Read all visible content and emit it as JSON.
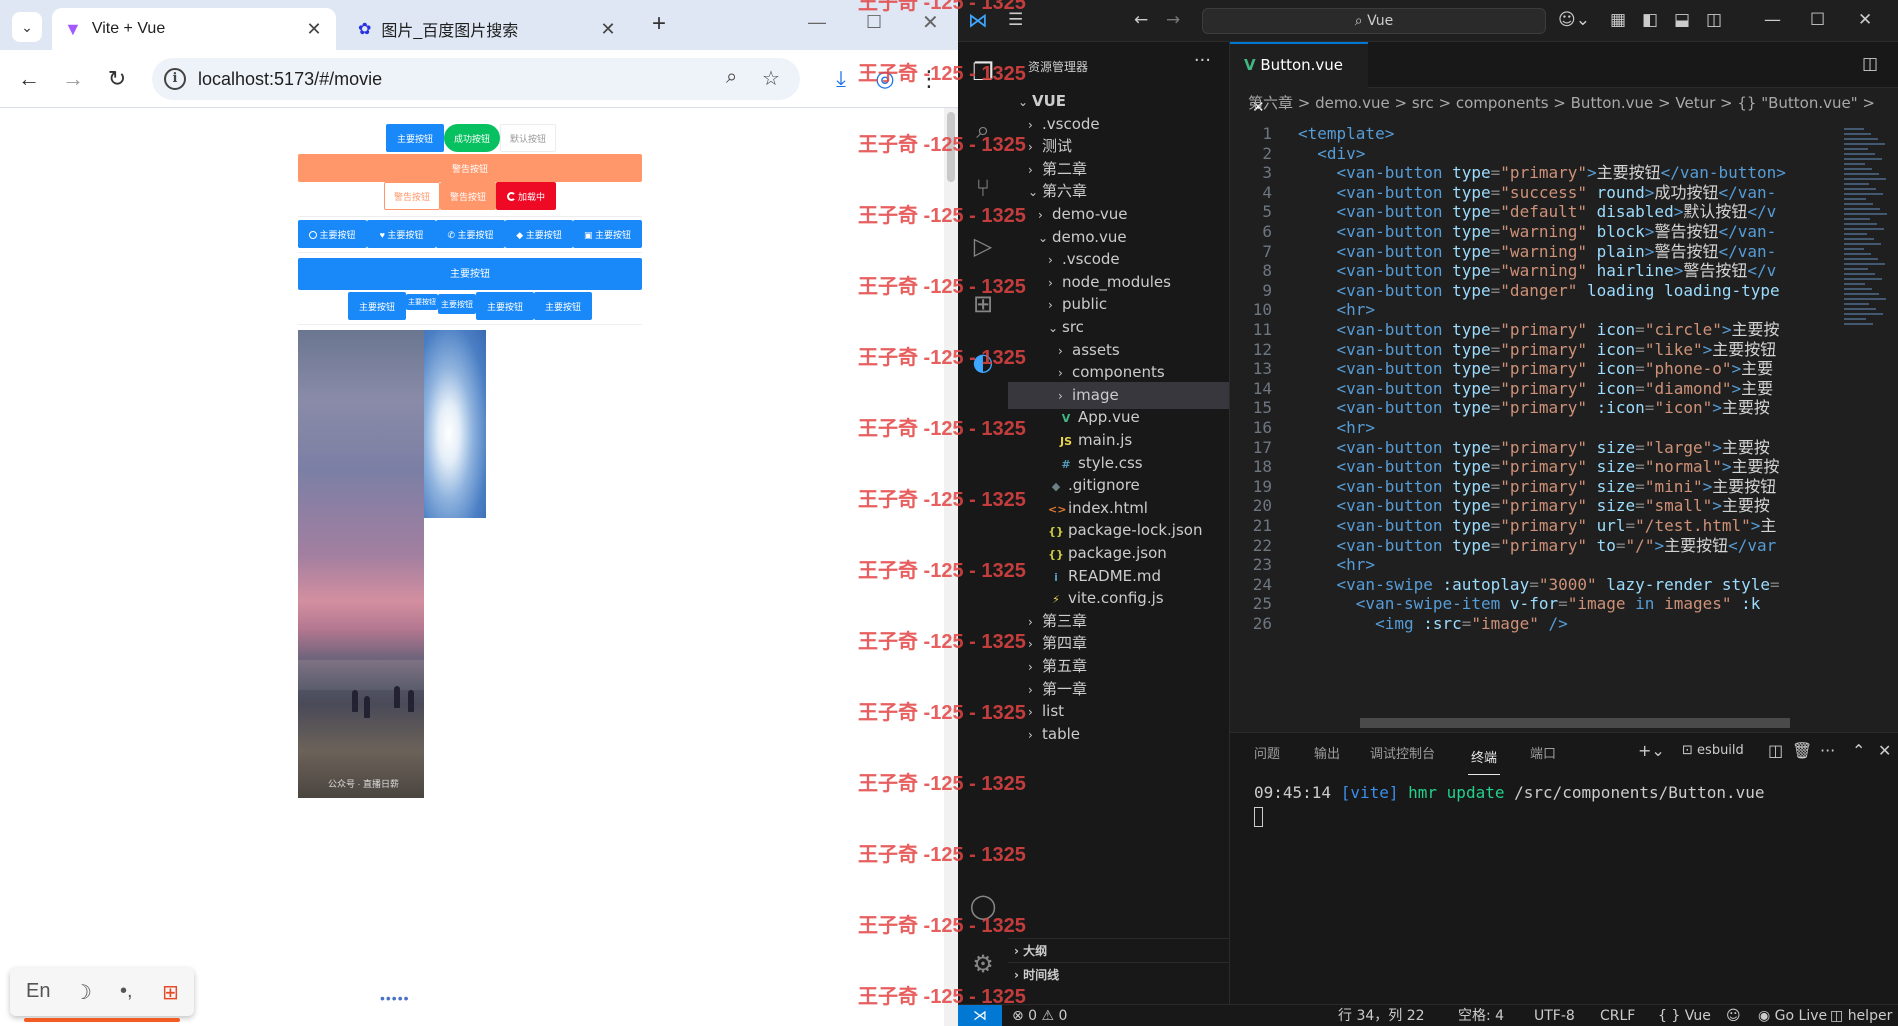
{
  "browser": {
    "tabs": [
      {
        "title": "Vite + Vue",
        "active": true,
        "icon": "vite-icon"
      },
      {
        "title": "图片_百度图片搜索",
        "active": false,
        "icon": "baidu-paw-icon"
      }
    ],
    "new_tab": "+",
    "address": "localhost:5173/#/movie",
    "page": {
      "row1": [
        "主要按钮",
        "成功按钮",
        "默认按钮"
      ],
      "block": "警告按钮",
      "row3": [
        "警告按钮",
        "警告按钮",
        "加载中"
      ],
      "icon_buttons": [
        "主要按钮",
        "主要按钮",
        "主要按钮",
        "主要按钮",
        "主要按钮"
      ],
      "large": "主要按钮",
      "sizes": [
        "主要按钮",
        "主要按钮",
        "主要按钮",
        "主要按钮",
        "主要按钮"
      ],
      "swipe_watermark": "公众号 · 直播日薪"
    },
    "ime": {
      "lang": "En",
      "moon": "☽",
      "punct": "•,",
      "apps": "⊞"
    }
  },
  "vscode": {
    "command_center": "Vue",
    "explorer_title": "资源管理器",
    "explorer_more": "···",
    "tree": [
      {
        "label": "VUE",
        "depth": 0,
        "chev": "v",
        "bold": true
      },
      {
        "label": ".vscode",
        "depth": 1,
        "chev": ">"
      },
      {
        "label": "测试",
        "depth": 1,
        "chev": ">"
      },
      {
        "label": "第二章",
        "depth": 1,
        "chev": ">"
      },
      {
        "label": "第六章",
        "depth": 1,
        "chev": "v"
      },
      {
        "label": "demo-vue",
        "depth": 2,
        "chev": ">"
      },
      {
        "label": "demo.vue",
        "depth": 2,
        "chev": "v"
      },
      {
        "label": ".vscode",
        "depth": 3,
        "chev": ">"
      },
      {
        "label": "node_modules",
        "depth": 3,
        "chev": ">"
      },
      {
        "label": "public",
        "depth": 3,
        "chev": ">"
      },
      {
        "label": "src",
        "depth": 3,
        "chev": "v"
      },
      {
        "label": "assets",
        "depth": 4,
        "chev": ">"
      },
      {
        "label": "components",
        "depth": 4,
        "chev": ">"
      },
      {
        "label": "image",
        "depth": 4,
        "chev": ">",
        "selected": true
      },
      {
        "label": "App.vue",
        "depth": 4,
        "icon": "V",
        "icon_color": "#41b883"
      },
      {
        "label": "main.js",
        "depth": 4,
        "icon": "JS",
        "icon_color": "#e8d44d"
      },
      {
        "label": "style.css",
        "depth": 4,
        "icon": "#",
        "icon_color": "#519aba"
      },
      {
        "label": ".gitignore",
        "depth": 3,
        "icon": "◆",
        "icon_color": "#6d8086"
      },
      {
        "label": "index.html",
        "depth": 3,
        "icon": "<>",
        "icon_color": "#e37933"
      },
      {
        "label": "package-lock.json",
        "depth": 3,
        "icon": "{}",
        "icon_color": "#cbcb41"
      },
      {
        "label": "package.json",
        "depth": 3,
        "icon": "{}",
        "icon_color": "#cbcb41"
      },
      {
        "label": "README.md",
        "depth": 3,
        "icon": "i",
        "icon_color": "#519aba"
      },
      {
        "label": "vite.config.js",
        "depth": 3,
        "icon": "⚡",
        "icon_color": "#e8d44d"
      },
      {
        "label": "第三章",
        "depth": 1,
        "chev": ">"
      },
      {
        "label": "第四章",
        "depth": 1,
        "chev": ">"
      },
      {
        "label": "第五章",
        "depth": 1,
        "chev": ">"
      },
      {
        "label": "第一章",
        "depth": 1,
        "chev": ">"
      },
      {
        "label": "list",
        "depth": 1,
        "chev": ">"
      },
      {
        "label": "table",
        "depth": 1,
        "chev": ">"
      }
    ],
    "outline": "大纲",
    "timeline": "时间线",
    "editor_tab": "Button.vue",
    "breadcrumbs": "第六章 > demo.vue > src > components > Button.vue > Vetur > {} \"Button.vue\" >",
    "code": [
      [
        [
          "tag",
          "<template>"
        ]
      ],
      [
        [
          "tag",
          "  <div>"
        ]
      ],
      [
        [
          "tag",
          "    <van-button "
        ],
        [
          "attr",
          "type"
        ],
        [
          "pun",
          "="
        ],
        [
          "str",
          "\"primary\""
        ],
        [
          "tag",
          ">"
        ],
        [
          "txt",
          "主要按钮"
        ],
        [
          "tag",
          "</van-button>"
        ]
      ],
      [
        [
          "tag",
          "    <van-button "
        ],
        [
          "attr",
          "type"
        ],
        [
          "pun",
          "="
        ],
        [
          "str",
          "\"success\""
        ],
        [
          "attr",
          " round"
        ],
        [
          "tag",
          ">"
        ],
        [
          "txt",
          "成功按钮"
        ],
        [
          "tag",
          "</van-"
        ]
      ],
      [
        [
          "tag",
          "    <van-button "
        ],
        [
          "attr",
          "type"
        ],
        [
          "pun",
          "="
        ],
        [
          "str",
          "\"default\""
        ],
        [
          "attr",
          " disabled"
        ],
        [
          "tag",
          ">"
        ],
        [
          "txt",
          "默认按钮"
        ],
        [
          "tag",
          "</v"
        ]
      ],
      [
        [
          "tag",
          "    <van-button "
        ],
        [
          "attr",
          "type"
        ],
        [
          "pun",
          "="
        ],
        [
          "str",
          "\"warning\""
        ],
        [
          "attr",
          " block"
        ],
        [
          "tag",
          ">"
        ],
        [
          "txt",
          "警告按钮"
        ],
        [
          "tag",
          "</van-"
        ]
      ],
      [
        [
          "tag",
          "    <van-button "
        ],
        [
          "attr",
          "type"
        ],
        [
          "pun",
          "="
        ],
        [
          "str",
          "\"warning\""
        ],
        [
          "attr",
          " plain"
        ],
        [
          "tag",
          ">"
        ],
        [
          "txt",
          "警告按钮"
        ],
        [
          "tag",
          "</van-"
        ]
      ],
      [
        [
          "tag",
          "    <van-button "
        ],
        [
          "attr",
          "type"
        ],
        [
          "pun",
          "="
        ],
        [
          "str",
          "\"warning\""
        ],
        [
          "attr",
          " hairline"
        ],
        [
          "tag",
          ">"
        ],
        [
          "txt",
          "警告按钮"
        ],
        [
          "tag",
          "</v"
        ]
      ],
      [
        [
          "tag",
          "    <van-button "
        ],
        [
          "attr",
          "type"
        ],
        [
          "pun",
          "="
        ],
        [
          "str",
          "\"danger\""
        ],
        [
          "attr",
          " loading loading-type"
        ]
      ],
      [
        [
          "tag",
          "    <hr>"
        ]
      ],
      [
        [
          "tag",
          "    <van-button "
        ],
        [
          "attr",
          "type"
        ],
        [
          "pun",
          "="
        ],
        [
          "str",
          "\"primary\""
        ],
        [
          "attr",
          " icon"
        ],
        [
          "pun",
          "="
        ],
        [
          "str",
          "\"circle\""
        ],
        [
          "tag",
          ">"
        ],
        [
          "txt",
          "主要按"
        ]
      ],
      [
        [
          "tag",
          "    <van-button "
        ],
        [
          "attr",
          "type"
        ],
        [
          "pun",
          "="
        ],
        [
          "str",
          "\"primary\""
        ],
        [
          "attr",
          " icon"
        ],
        [
          "pun",
          "="
        ],
        [
          "str",
          "\"like\""
        ],
        [
          "tag",
          ">"
        ],
        [
          "txt",
          "主要按钮"
        ]
      ],
      [
        [
          "tag",
          "    <van-button "
        ],
        [
          "attr",
          "type"
        ],
        [
          "pun",
          "="
        ],
        [
          "str",
          "\"primary\""
        ],
        [
          "attr",
          " icon"
        ],
        [
          "pun",
          "="
        ],
        [
          "str",
          "\"phone-o\""
        ],
        [
          "tag",
          ">"
        ],
        [
          "txt",
          "主要"
        ]
      ],
      [
        [
          "tag",
          "    <van-button "
        ],
        [
          "attr",
          "type"
        ],
        [
          "pun",
          "="
        ],
        [
          "str",
          "\"primary\""
        ],
        [
          "attr",
          " icon"
        ],
        [
          "pun",
          "="
        ],
        [
          "str",
          "\"diamond\""
        ],
        [
          "tag",
          ">"
        ],
        [
          "txt",
          "主要"
        ]
      ],
      [
        [
          "tag",
          "    <van-button "
        ],
        [
          "attr",
          "type"
        ],
        [
          "pun",
          "="
        ],
        [
          "str",
          "\"primary\""
        ],
        [
          "attr",
          " :icon"
        ],
        [
          "pun",
          "="
        ],
        [
          "str",
          "\"icon\""
        ],
        [
          "tag",
          ">"
        ],
        [
          "txt",
          "主要按"
        ]
      ],
      [
        [
          "tag",
          "    <hr>"
        ]
      ],
      [
        [
          "tag",
          "    <van-button "
        ],
        [
          "attr",
          "type"
        ],
        [
          "pun",
          "="
        ],
        [
          "str",
          "\"primary\""
        ],
        [
          "attr",
          " size"
        ],
        [
          "pun",
          "="
        ],
        [
          "str",
          "\"large\""
        ],
        [
          "tag",
          ">"
        ],
        [
          "txt",
          "主要按"
        ]
      ],
      [
        [
          "tag",
          "    <van-button "
        ],
        [
          "attr",
          "type"
        ],
        [
          "pun",
          "="
        ],
        [
          "str",
          "\"primary\""
        ],
        [
          "attr",
          " size"
        ],
        [
          "pun",
          "="
        ],
        [
          "str",
          "\"normal\""
        ],
        [
          "tag",
          ">"
        ],
        [
          "txt",
          "主要按"
        ]
      ],
      [
        [
          "tag",
          "    <van-button "
        ],
        [
          "attr",
          "type"
        ],
        [
          "pun",
          "="
        ],
        [
          "str",
          "\"primary\""
        ],
        [
          "attr",
          " size"
        ],
        [
          "pun",
          "="
        ],
        [
          "str",
          "\"mini\""
        ],
        [
          "tag",
          ">"
        ],
        [
          "txt",
          "主要按钮"
        ]
      ],
      [
        [
          "tag",
          "    <van-button "
        ],
        [
          "attr",
          "type"
        ],
        [
          "pun",
          "="
        ],
        [
          "str",
          "\"primary\""
        ],
        [
          "attr",
          " size"
        ],
        [
          "pun",
          "="
        ],
        [
          "str",
          "\"small\""
        ],
        [
          "tag",
          ">"
        ],
        [
          "txt",
          "主要按"
        ]
      ],
      [
        [
          "tag",
          "    <van-button "
        ],
        [
          "attr",
          "type"
        ],
        [
          "pun",
          "="
        ],
        [
          "str",
          "\"primary\""
        ],
        [
          "attr",
          " url"
        ],
        [
          "pun",
          "="
        ],
        [
          "str",
          "\"/test.html\""
        ],
        [
          "tag",
          ">"
        ],
        [
          "txt",
          "主"
        ]
      ],
      [
        [
          "tag",
          "    <van-button "
        ],
        [
          "attr",
          "type"
        ],
        [
          "pun",
          "="
        ],
        [
          "str",
          "\"primary\""
        ],
        [
          "attr",
          " to"
        ],
        [
          "pun",
          "="
        ],
        [
          "str",
          "\"/\""
        ],
        [
          "tag",
          ">"
        ],
        [
          "txt",
          "主要按钮"
        ],
        [
          "tag",
          "</var"
        ]
      ],
      [
        [
          "tag",
          "    <hr>"
        ]
      ],
      [
        [
          "tag",
          "    <van-swipe "
        ],
        [
          "attr",
          ":autoplay"
        ],
        [
          "pun",
          "="
        ],
        [
          "str",
          "\"3000\""
        ],
        [
          "attr",
          " lazy-render style"
        ],
        [
          "pun",
          "="
        ]
      ],
      [
        [
          "tag",
          "      <van-swipe-item "
        ],
        [
          "attr",
          "v-for"
        ],
        [
          "pun",
          "="
        ],
        [
          "str",
          "\"image "
        ],
        [
          "tag",
          "in"
        ],
        [
          "str",
          " images\""
        ],
        [
          "attr",
          " :k"
        ]
      ],
      [
        [
          "tag",
          "        <img "
        ],
        [
          "attr",
          ":src"
        ],
        [
          "pun",
          "="
        ],
        [
          "str",
          "\"image\""
        ],
        [
          "tag",
          " />"
        ]
      ]
    ],
    "panel_tabs": [
      "问题",
      "输出",
      "调试控制台",
      "终端",
      "端口"
    ],
    "panel_active": "终端",
    "terminal_name": "esbuild",
    "terminal": {
      "time": "09:45:14",
      "tag": "[vite]",
      "msg": "hmr update",
      "path": "/src/components/Button.vue"
    },
    "status": {
      "errors": "⊗ 0 ⚠ 0",
      "position": "行 34，列 22",
      "spaces": "空格: 4",
      "encoding": "UTF-8",
      "eol": "CRLF",
      "lang": "{ } Vue",
      "golive": "Go Live",
      "helper": "helper"
    }
  },
  "watermark": "王子奇 -125 - 1325"
}
